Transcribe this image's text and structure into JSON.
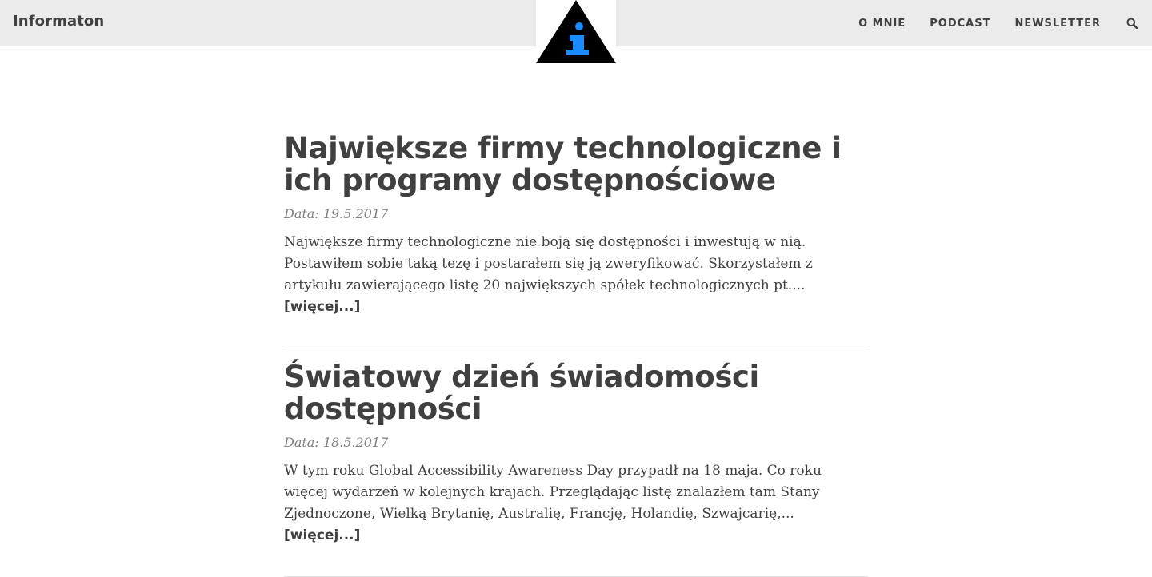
{
  "navbar": {
    "brand": "Informaton",
    "logo_icon": "info-i-triangle-icon",
    "links": [
      "O MNIE",
      "PODCAST",
      "NEWSLETTER"
    ],
    "search_icon": "search-icon"
  },
  "colors": {
    "navbar_bg": "#ebebeb",
    "text": "#404040",
    "meta": "#808080",
    "logo_accent": "#1a8cff"
  },
  "posts": [
    {
      "title": "Największe firmy technologiczne i ich programy dostępnościowe",
      "date": "Data: 19.5.2017",
      "excerpt": "Największe firmy technologiczne nie boją się dostępności i inwestują w nią. Postawiłem sobie taką tezę i postarałem się ją zweryfikować. Skorzystałem z artykułu zawierającego listę 20 największych spółek technologicznych pt.... ",
      "more": "[więcej...]"
    },
    {
      "title": "Światowy dzień świadomości dostępności",
      "date": "Data: 18.5.2017",
      "excerpt": "W tym roku Global Accessibility Awareness Day przypadł na 18 maja. Co roku więcej wydarzeń w kolejnych krajach. Przeglądając listę znalazłem tam Stany Zjednoczone, Wielką Brytanię, Australię, Francję, Holandię, Szwajcarię,... ",
      "more": "[więcej...]"
    }
  ]
}
